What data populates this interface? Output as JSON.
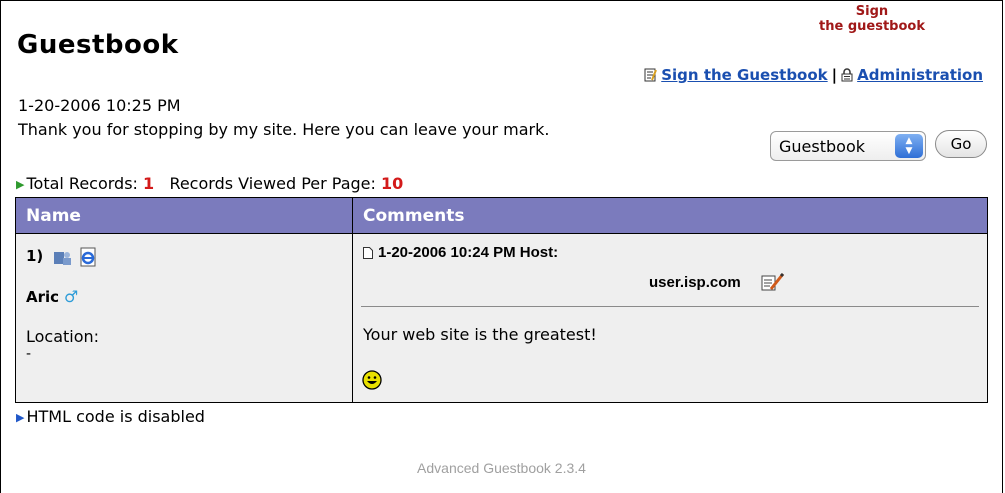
{
  "page": {
    "title": "Guestbook",
    "sign_logo_line1": "Sign",
    "sign_logo_line2": "the guestbook",
    "links": {
      "sign": "Sign the Guestbook",
      "separator": "|",
      "admin": "Administration"
    },
    "datetime": "1-20-2006 10:25 PM",
    "intro": "Thank you for stopping by my site. Here you can leave your mark."
  },
  "nav": {
    "select_value": "Guestbook",
    "go_label": "Go"
  },
  "totals": {
    "total_label": "Total Records:",
    "total_value": "1",
    "per_page_label": "Records Viewed Per Page:",
    "per_page_value": "10"
  },
  "table": {
    "headers": [
      "Name",
      "Comments"
    ],
    "entries": [
      {
        "number": "1)",
        "name": "Aric",
        "gender_symbol": "♂",
        "location_label": "Location:",
        "location_value": "-",
        "timestamp_host": "1-20-2006 10:24 PM Host:",
        "host": "user.isp.com",
        "comment": "Your web site is the greatest!",
        "icons": [
          "user-profile-icon",
          "ie-homepage-icon",
          "document-icon",
          "edit-icon",
          "smiley-icon"
        ]
      }
    ]
  },
  "notes": {
    "html_status": "HTML code is disabled"
  },
  "footer": {
    "credit": "Advanced Guestbook 2.3.4"
  },
  "colors": {
    "header_bg": "#7b7bbd",
    "cell_bg": "#efefef",
    "link": "#1a4fb0",
    "accent_red": "#d31a1a",
    "logo_red": "#a01818"
  }
}
